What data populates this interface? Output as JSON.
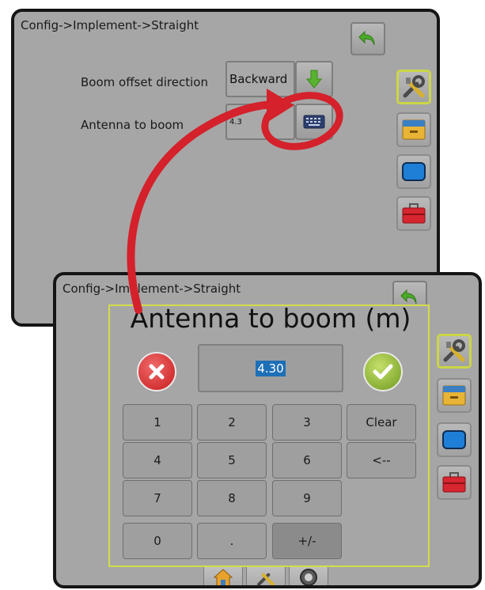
{
  "back_screen": {
    "title": "Config->Implement->Straight",
    "boom_offset_label": "Boom offset direction",
    "boom_offset_value": "Backward",
    "antenna_label": "Antenna to boom",
    "antenna_value_partial": "4.3"
  },
  "front_screen": {
    "title": "Config->Implement->Straight",
    "dialog": {
      "title": "Antenna to boom (m)",
      "value": "4.30",
      "keys": [
        "1",
        "2",
        "3",
        "Clear",
        "4",
        "5",
        "6",
        "<--",
        "7",
        "8",
        "9",
        "0",
        ".",
        "+/-"
      ]
    }
  },
  "colors": {
    "screen_bg": "#a6a6a6",
    "bezel": "#151515",
    "highlight_border": "#cbd646",
    "annotation_red": "#d4212b",
    "value_highlight": "#1d6fb7"
  },
  "icons": {
    "back": "back-arrow-icon",
    "down": "down-arrow-icon",
    "keyboard": "keyboard-icon",
    "tools": "tools-icon",
    "drawer": "drawer-icon",
    "display": "display-icon",
    "toolbox": "toolbox-icon",
    "cancel": "cancel-x-icon",
    "accept": "checkmark-icon",
    "home": "home-icon",
    "gps": "gps-icon"
  }
}
